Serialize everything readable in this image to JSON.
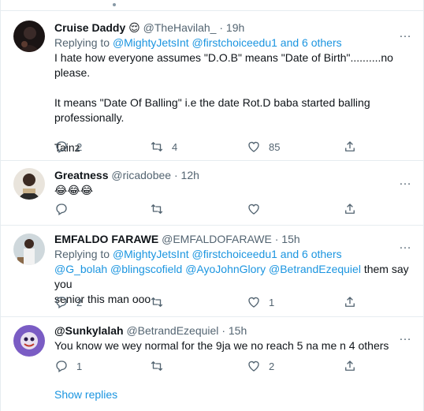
{
  "tweets": [
    {
      "name": "Cruise Daddy",
      "emoji": "😌",
      "handle": "@TheHavilah_",
      "separator": "·",
      "time": "19h",
      "replying_prefix": "Replying to",
      "replying_mention1": "@MightyJetsInt",
      "replying_mention2": "@firstchoiceedu1",
      "replying_and": "and",
      "replying_others": "6 others",
      "line1": "I hate how everyone assumes \"D.O.B\" means \"Date of Birth\"..........no please.",
      "line2": "It means \"Date Of Balling\" i.e the date Rot.D baba started balling professionally.",
      "line3": "Tainz",
      "replies": "2",
      "retweets": "4",
      "likes": "85"
    },
    {
      "name": "Greatness",
      "handle": "@ricadobee",
      "separator": "·",
      "time": "12h",
      "text": "😂😂😂",
      "replies": "",
      "retweets": "",
      "likes": ""
    },
    {
      "name": "EMFALDO FARAWE",
      "handle": "@EMFALDOFARAWE",
      "separator": "·",
      "time": "15h",
      "replying_prefix": "Replying to",
      "replying_mention1": "@MightyJetsInt",
      "replying_mention2": "@firstchoiceedu1",
      "replying_and": "and",
      "replying_others": "6 others",
      "mentions": [
        "@G_bolah",
        "@blingscofield",
        "@AyoJohnGlory",
        "@BetrandEzequiel"
      ],
      "text_after": "them say you",
      "text_line2": "senior this man ooo",
      "replies": "2",
      "retweets": "",
      "likes": "1"
    },
    {
      "name": "@Sunkylalah",
      "handle": "@BetrandEzequiel",
      "separator": "·",
      "time": "15h",
      "text": "You know we wey normal for the 9ja we no reach 5 na me n 4 others",
      "replies": "1",
      "retweets": "",
      "likes": "2"
    }
  ],
  "more_icon": "…",
  "show_replies": "Show replies",
  "colors": {
    "link": "#1b95e0",
    "muted": "#536471",
    "border": "#e6ecf0"
  }
}
